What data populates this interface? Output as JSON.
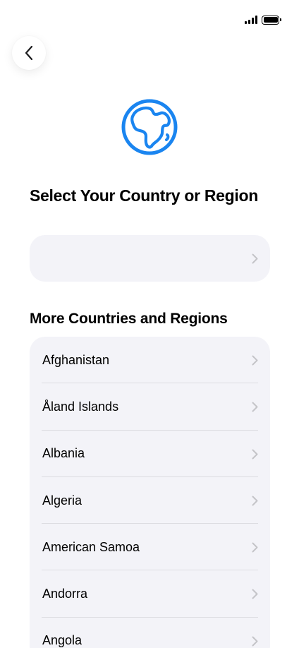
{
  "title": "Select Your Country or Region",
  "section_title": "More Countries and Regions",
  "suggested": {
    "label": ""
  },
  "countries": [
    {
      "name": "Afghanistan"
    },
    {
      "name": "Åland Islands"
    },
    {
      "name": "Albania"
    },
    {
      "name": "Algeria"
    },
    {
      "name": "American Samoa"
    },
    {
      "name": "Andorra"
    },
    {
      "name": "Angola"
    }
  ],
  "icons": {
    "back": "chevron-left-icon",
    "globe": "globe-africa-icon",
    "row_chevron": "chevron-right-icon",
    "signal": "cellular-signal-icon",
    "battery": "battery-icon"
  },
  "colors": {
    "accent": "#1a85f0",
    "card_background": "#f3f3f8",
    "chevron": "#c4c4c8",
    "separator": "#dcdce1"
  }
}
